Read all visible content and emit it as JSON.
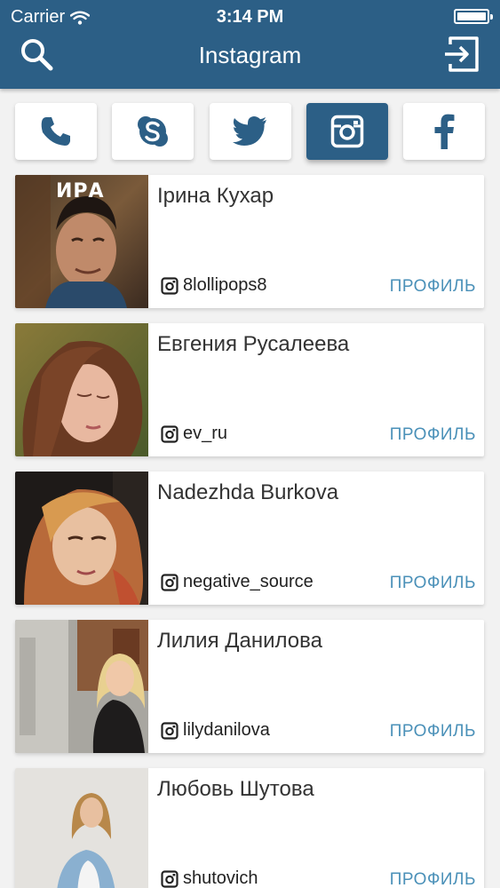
{
  "status_bar": {
    "carrier": "Carrier",
    "time": "3:14 PM"
  },
  "header": {
    "title": "Instagram",
    "left_icon": "search-icon",
    "right_icon": "logout-icon"
  },
  "tabs": [
    {
      "icon": "phone-icon",
      "active": false
    },
    {
      "icon": "skype-icon",
      "active": false
    },
    {
      "icon": "twitter-icon",
      "active": false
    },
    {
      "icon": "instagram-icon",
      "active": true
    },
    {
      "icon": "facebook-icon",
      "active": false
    }
  ],
  "users": [
    {
      "name": "Ірина Кухар",
      "handle": "8lollipops8",
      "action": "ПРОФИЛЬ",
      "avatar_caption": "ИРА"
    },
    {
      "name": "Евгения Русалеева",
      "handle": "ev_ru",
      "action": "ПРОФИЛЬ"
    },
    {
      "name": "Nadezhda Burkova",
      "handle": "negative_source",
      "action": "ПРОФИЛЬ"
    },
    {
      "name": "Лилия Данилова",
      "handle": "lilydanilova",
      "action": "ПРОФИЛЬ"
    },
    {
      "name": "Любовь Шутова",
      "handle": "shutovich",
      "action": "ПРОФИЛЬ"
    }
  ],
  "colors": {
    "header_bg": "#2c5f86",
    "accent_link": "#4a90b8",
    "page_bg": "#f2f2f2"
  }
}
